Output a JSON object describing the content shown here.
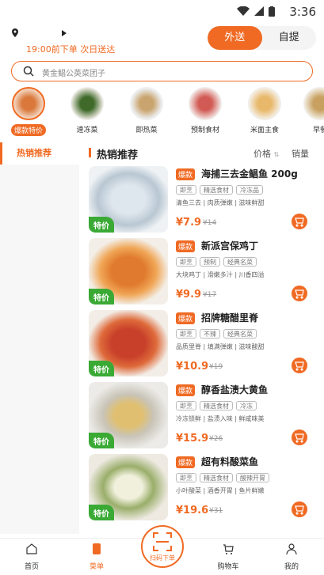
{
  "status_bar": {
    "time": "3:36"
  },
  "header": {
    "location_text": "",
    "delivery_note": "19:00前下单 次日送达",
    "modes": [
      {
        "label": "外送",
        "active": true
      },
      {
        "label": "自提",
        "active": false
      }
    ],
    "search_placeholder": "黄金鲳公英菜团子"
  },
  "categories": [
    {
      "label": "爆款特价",
      "active": true
    },
    {
      "label": "速冻菜",
      "active": false
    },
    {
      "label": "即热菜",
      "active": false
    },
    {
      "label": "预制食材",
      "active": false
    },
    {
      "label": "米面主食",
      "active": false
    },
    {
      "label": "早餐",
      "active": false
    }
  ],
  "sidebar": {
    "items": [
      {
        "label": "热销推荐",
        "active": true
      }
    ]
  },
  "list_header": {
    "title": "热销推荐",
    "sort_price": "价格",
    "sort_sales": "销量"
  },
  "products": [
    {
      "badge": "爆款",
      "name": "海捕三去金鲳鱼 200g",
      "tags": [
        "即烹",
        "精选食材",
        "冷冻品"
      ],
      "desc": "清鱼三去 | 肉质弹嫩 | 滋味鲜甜",
      "price": "¥7.9",
      "orig": "¥14",
      "tejia": "特价"
    },
    {
      "badge": "爆款",
      "name": "新派宫保鸡丁",
      "tags": [
        "即烹",
        "预制",
        "经典名菜"
      ],
      "desc": "大块鸡丁 | 滑嫩多汁 | 川香四溢",
      "price": "¥9.9",
      "orig": "¥17",
      "tejia": "特价"
    },
    {
      "badge": "爆款",
      "name": "招牌糖醋里脊",
      "tags": [
        "即烹",
        "不辣",
        "经典名菜"
      ],
      "desc": "品质里脊 | 填满弹嫩 | 滋味酸甜",
      "price": "¥10.9",
      "orig": "¥19",
      "tejia": "特价"
    },
    {
      "badge": "爆款",
      "name": "醇香盐渍大黄鱼",
      "tags": [
        "即烹",
        "精选食材",
        "冷冻"
      ],
      "desc": "冷冻锁鲜 | 盐渍入味 | 鲜咸味美",
      "price": "¥15.9",
      "orig": "¥26",
      "tejia": "特价"
    },
    {
      "badge": "爆款",
      "name": "超有料酸菜鱼",
      "tags": [
        "即烹",
        "精选食材",
        "酸辣开胃"
      ],
      "desc": "小叶酸菜 | 酒香开胃 | 鱼片鲜嫩",
      "price": "¥19.6",
      "orig": "¥31",
      "tejia": "特价"
    }
  ],
  "tabbar": {
    "tabs": [
      {
        "label": "首页"
      },
      {
        "label": "菜单"
      },
      {
        "label": "购物车"
      },
      {
        "label": "我的"
      }
    ],
    "scan_label": "扫码下单"
  }
}
